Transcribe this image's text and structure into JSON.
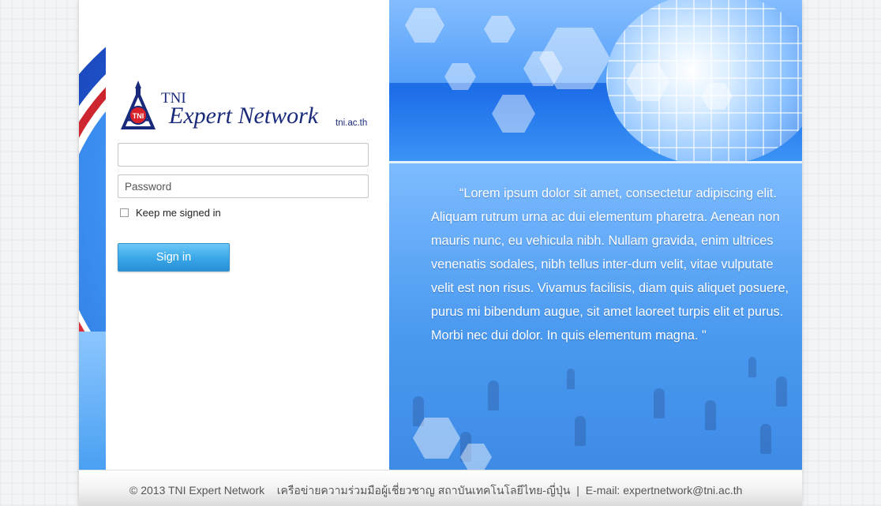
{
  "brand": {
    "prefix": "TNI",
    "name": "Expert Network",
    "domain": "tni.ac.th",
    "emblem_text": "TNI"
  },
  "login": {
    "username_placeholder": "",
    "username_value": "",
    "password_placeholder": "Password",
    "keep_signed_in_label": "Keep me signed in",
    "keep_signed_in_checked": false,
    "signin_label": "Sign in"
  },
  "hero": {
    "quote": "“Lorem ipsum dolor sit amet, consectetur adipiscing elit. Aliquam rutrum urna ac dui elementum pharetra. Aenean non mauris nunc, eu vehicula nibh. Nullam gravida, enim ultrices venenatis sodales, nibh tellus inter-dum velit, vitae vulputate velit est non risus. Vivamus facilisis, diam quis aliquet posuere, purus mi bibendum augue, sit amet laoreet turpis elit et purus. Morbi nec dui dolor. In quis elementum magna. \""
  },
  "footer": {
    "copyright": "© 2013 TNI Expert Network",
    "thai_text": "เครือข่ายความร่วมมือผู้เชี่ยวชาญ สถาบันเทคโนโลยีไทย-ญี่ปุ่น",
    "separator": "|",
    "email": "E-mail: expertnetwork@tni.ac.th"
  },
  "colors": {
    "brand_navy": "#1a2a7a",
    "accent_blue": "#1e4fc6",
    "accent_red": "#c8202a",
    "button_blue": "#38a6e8"
  }
}
